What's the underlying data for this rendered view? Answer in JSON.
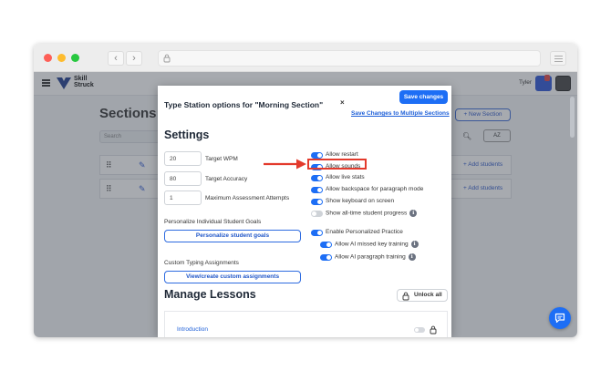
{
  "header": {
    "logo_line1": "Skill",
    "logo_line2": "Struck",
    "user_name": "Tyler"
  },
  "background_page": {
    "title": "Sections",
    "search_placeholder": "Search",
    "new_section_label": "+ New Section",
    "sort_label": "AZ",
    "add_students_label": "+ Add students"
  },
  "modal": {
    "title": "Type Station options for \"Morning Section\"",
    "close_label": "×",
    "save_label": "Save changes",
    "save_multi_label": "Save Changes to Multiple Sections",
    "settings_heading": "Settings",
    "numeric_fields": [
      {
        "value": "20",
        "label": "Target WPM"
      },
      {
        "value": "80",
        "label": "Target Accuracy"
      },
      {
        "value": "1",
        "label": "Maximum Assessment Attempts"
      }
    ],
    "personalize_label": "Personalize Individual Student Goals",
    "personalize_button": "Personalize student goals",
    "custom_label": "Custom Typing Assignments",
    "custom_button": "View/create custom assignments",
    "toggles": [
      {
        "label": "Allow restart",
        "on": true
      },
      {
        "label": "Allow sounds",
        "on": true
      },
      {
        "label": "Allow live stats",
        "on": true
      },
      {
        "label": "Allow backspace for paragraph mode",
        "on": true
      },
      {
        "label": "Show keyboard on screen",
        "on": true
      },
      {
        "label": "Show all-time student progress",
        "on": false
      },
      {
        "label": "Enable Personalized Practice",
        "on": true
      },
      {
        "label": "Allow AI missed key training",
        "on": true
      },
      {
        "label": "Allow AI paragraph training",
        "on": true
      }
    ],
    "manage_heading": "Manage Lessons",
    "unlock_all_label": "Unlock all",
    "lessons": [
      {
        "name": "Introduction"
      }
    ]
  },
  "colors": {
    "accent": "#1d6ef5",
    "highlight": "#e33a2c",
    "overlay": "#3c424e"
  }
}
